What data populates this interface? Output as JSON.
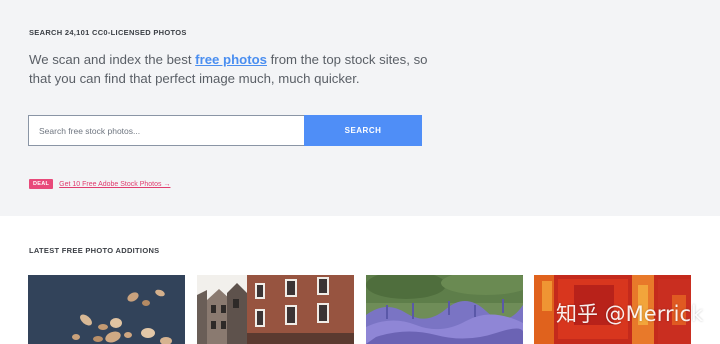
{
  "hero": {
    "eyebrow": "SEARCH 24,101 CC0-LICENSED PHOTOS",
    "lead_before": "We scan and index the best ",
    "lead_link": "free photos",
    "lead_after": " from the top stock sites, so that you can find that perfect image much, much quicker."
  },
  "search": {
    "placeholder": "Search free stock photos...",
    "button_label": "SEARCH"
  },
  "deal": {
    "badge": "DEAL",
    "link_text": "Get 10 Free Adobe Stock Photos →"
  },
  "latest": {
    "title": "LATEST FREE PHOTO ADDITIONS",
    "photos": [
      {
        "subject": "wood shavings on blue"
      },
      {
        "subject": "brick townhouses"
      },
      {
        "subject": "lavender field"
      },
      {
        "subject": "red abstract painting"
      }
    ]
  },
  "watermark": "知乎 @Merrick",
  "colors": {
    "accent": "#4f8ef7",
    "deal": "#e8497a",
    "hero_bg": "#f3f4f6"
  }
}
